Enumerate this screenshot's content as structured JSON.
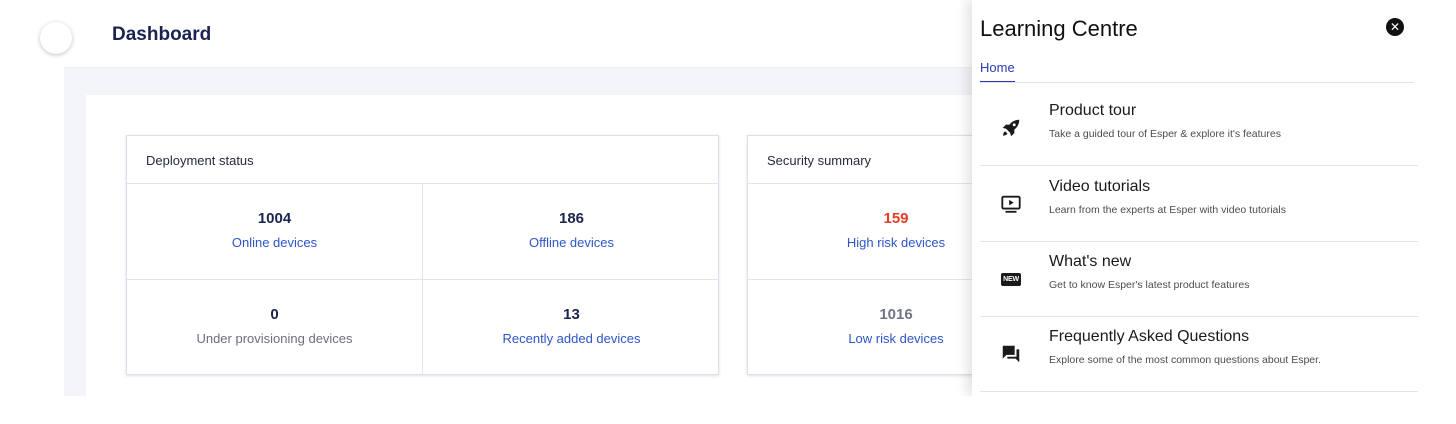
{
  "header": {
    "title": "Dashboard"
  },
  "deployment": {
    "title": "Deployment status",
    "cells": [
      {
        "value": "1004",
        "label": "Online devices"
      },
      {
        "value": "186",
        "label": "Offline devices"
      },
      {
        "value": "0",
        "label": "Under provisioning devices"
      },
      {
        "value": "13",
        "label": "Recently added devices"
      }
    ]
  },
  "security": {
    "title": "Security summary",
    "cells": [
      {
        "value": "159",
        "label": "High risk devices",
        "color": "#e03f25"
      },
      {
        "value": "1016",
        "label": "Low risk devices",
        "color": "#707585"
      }
    ]
  },
  "learning_centre": {
    "title": "Learning Centre",
    "tab": "Home",
    "items": [
      {
        "icon": "rocket-icon",
        "title": "Product tour",
        "description": "Take a guided tour of Esper & explore it's features"
      },
      {
        "icon": "video-play-icon",
        "title": "Video tutorials",
        "description": "Learn from the experts at Esper with video tutorials"
      },
      {
        "icon": "new-badge-icon",
        "badge": "NEW",
        "title": "What's new",
        "description": "Get to know Esper's latest product features"
      },
      {
        "icon": "chat-icon",
        "title": "Frequently Asked Questions",
        "description": "Explore some of the most common questions about Esper."
      }
    ]
  }
}
